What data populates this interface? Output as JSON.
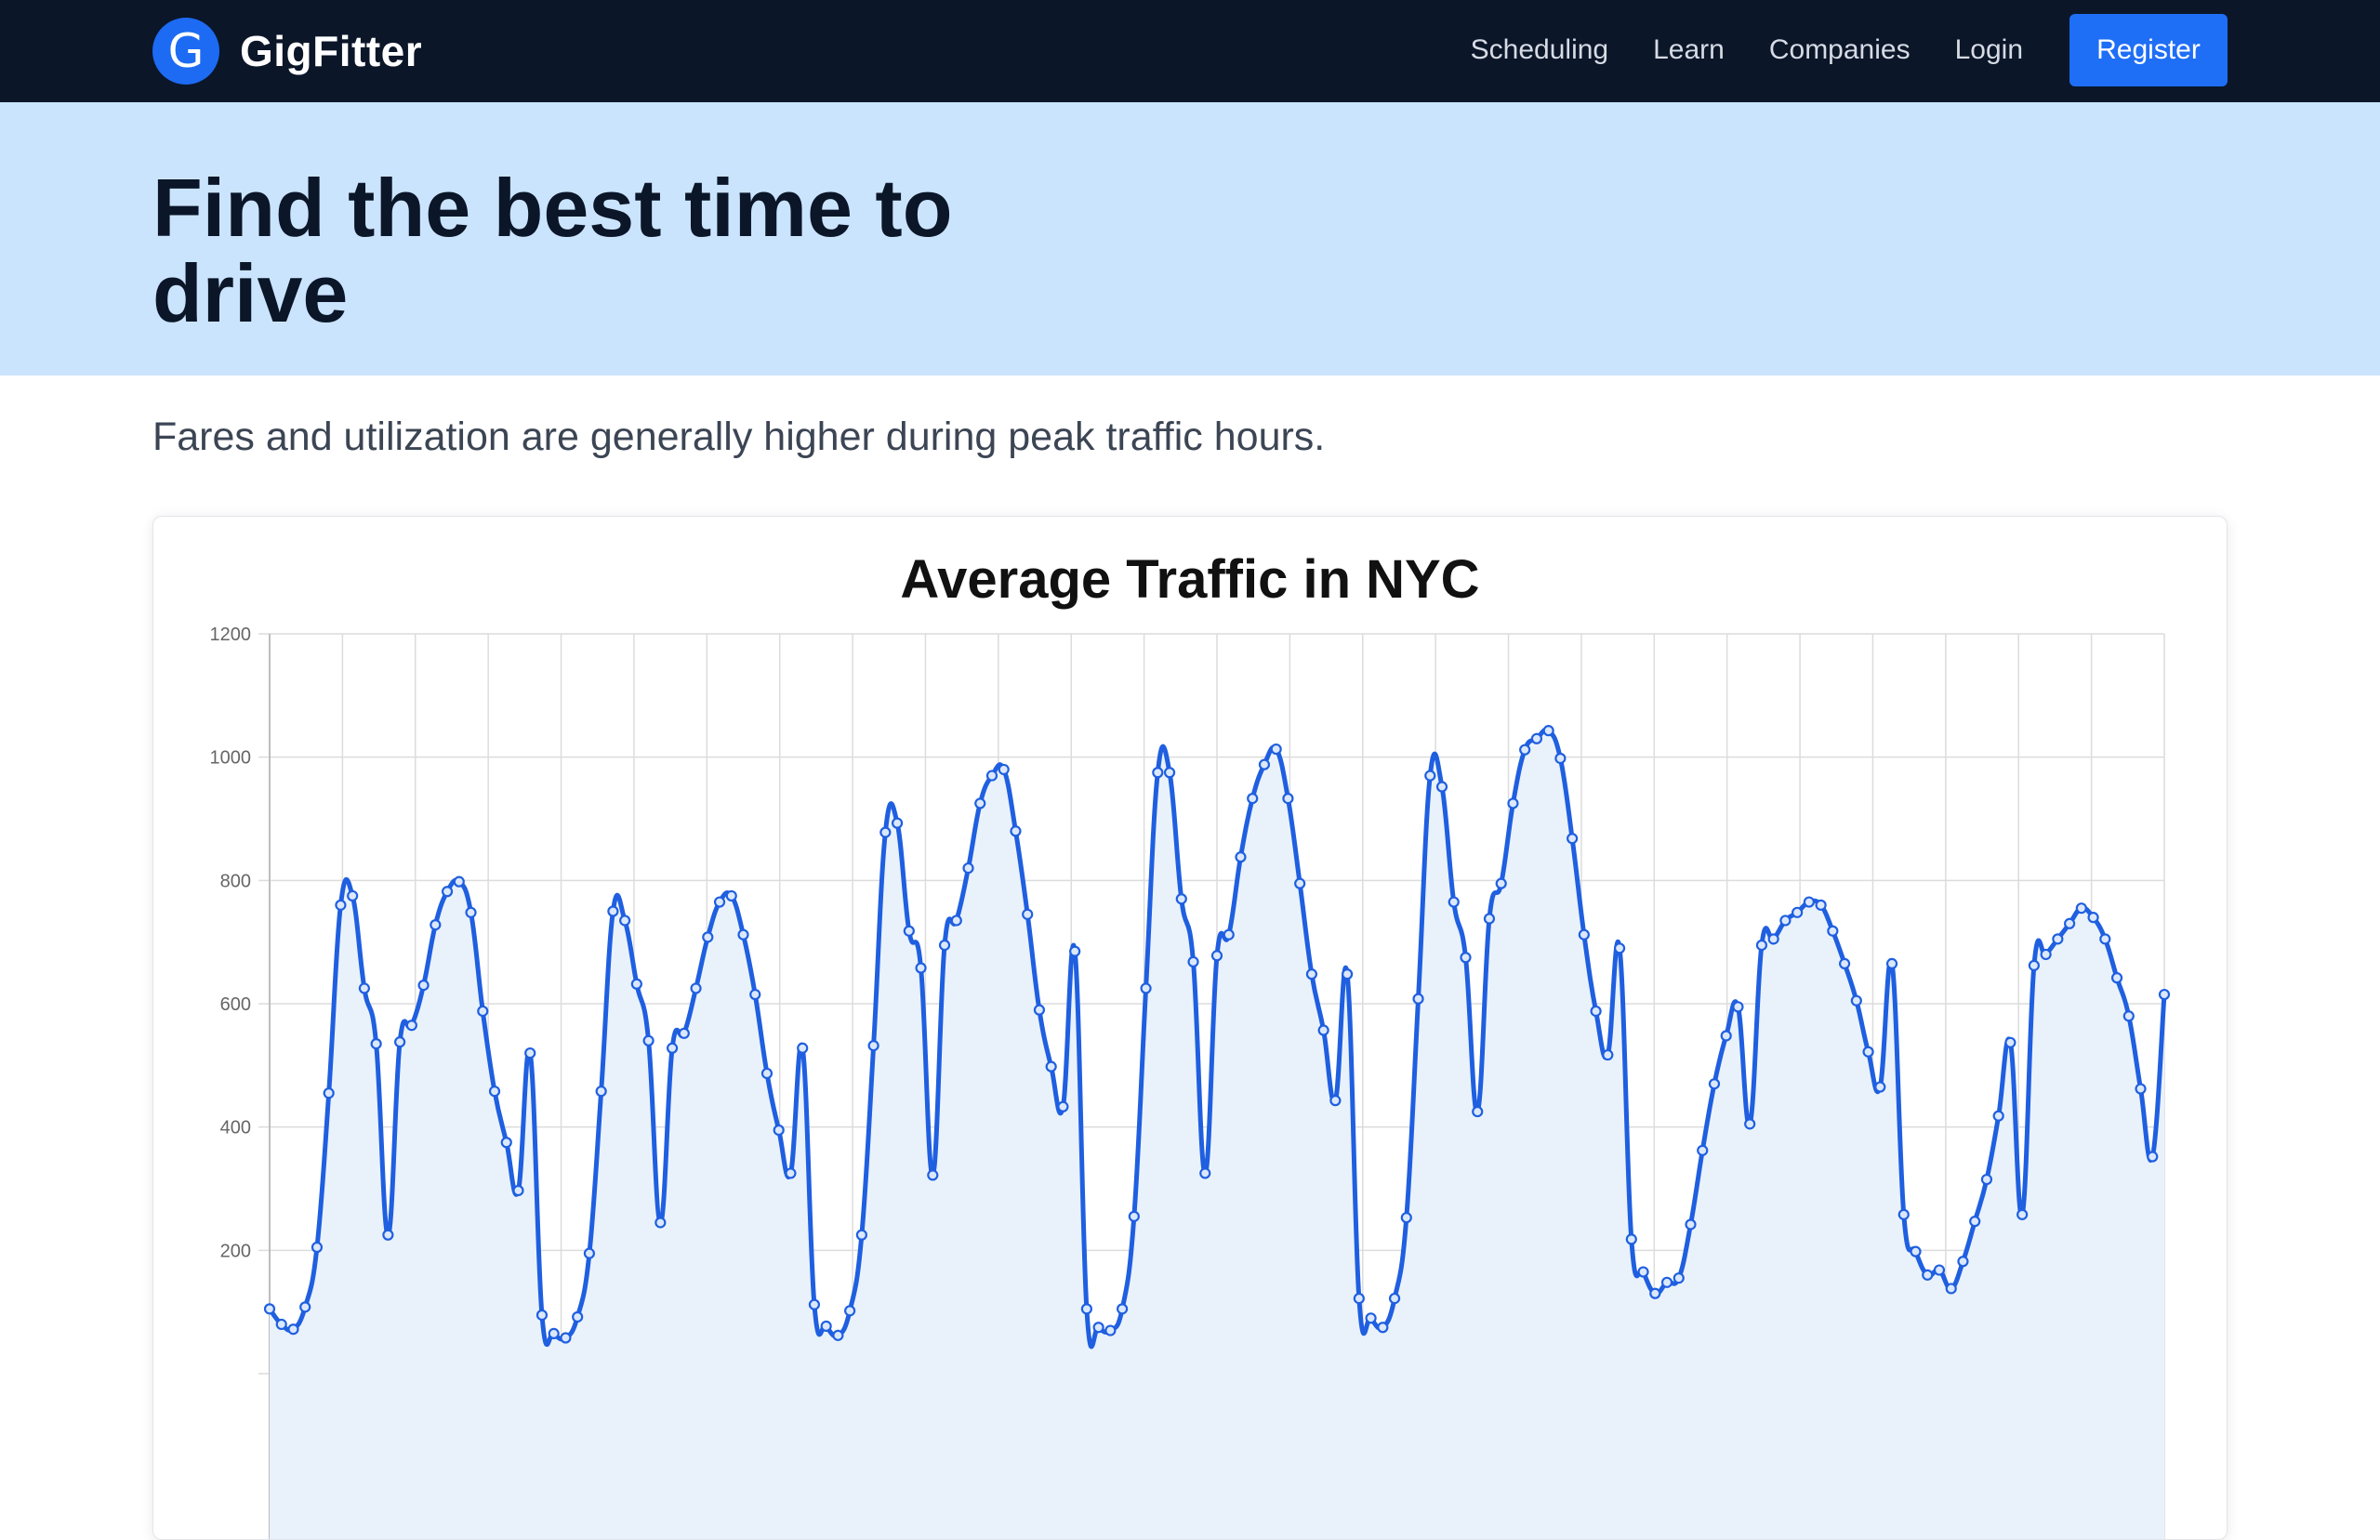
{
  "navbar": {
    "brand_letter": "G",
    "brand_name": "GigFitter",
    "links": [
      "Scheduling",
      "Learn",
      "Companies",
      "Login"
    ],
    "register_label": "Register",
    "background": "#0b1629",
    "accent": "#1f6ef6"
  },
  "hero": {
    "title": "Find the best time to drive",
    "background": "#cbe4fd"
  },
  "subtitle": "Fares and utilization are generally higher during peak traffic hours.",
  "chart_data": {
    "type": "area",
    "title": "Average Traffic in NYC",
    "xlabel": "",
    "ylabel": "",
    "ylim": [
      0,
      1200
    ],
    "y_ticks": [
      200,
      400,
      600,
      800,
      1000,
      1200
    ],
    "grid": true,
    "line_color": "#1f5fe0",
    "fill_color": "#e9f2fb",
    "values": [
      105,
      80,
      72,
      108,
      205,
      455,
      760,
      775,
      625,
      535,
      225,
      538,
      565,
      630,
      728,
      782,
      798,
      748,
      588,
      458,
      375,
      297,
      520,
      95,
      65,
      58,
      92,
      195,
      458,
      750,
      735,
      632,
      540,
      245,
      528,
      552,
      625,
      708,
      765,
      775,
      712,
      615,
      487,
      395,
      325,
      528,
      112,
      77,
      62,
      102,
      225,
      532,
      878,
      893,
      718,
      658,
      322,
      695,
      735,
      820,
      925,
      970,
      980,
      880,
      745,
      590,
      498,
      433,
      685,
      105,
      75,
      70,
      105,
      255,
      625,
      975,
      975,
      770,
      668,
      325,
      678,
      712,
      838,
      933,
      988,
      1013,
      933,
      795,
      648,
      557,
      443,
      648,
      122,
      90,
      75,
      122,
      253,
      608,
      970,
      952,
      765,
      675,
      425,
      738,
      795,
      925,
      1012,
      1030,
      1043,
      998,
      868,
      712,
      588,
      517,
      690,
      218,
      165,
      130,
      148,
      155,
      242,
      362,
      470,
      548,
      595,
      405,
      695,
      705,
      735,
      748,
      765,
      760,
      718,
      665,
      605,
      522,
      465,
      665,
      258,
      198,
      160,
      168,
      138,
      182,
      247,
      315,
      418,
      537,
      258,
      662,
      680,
      705,
      730,
      755,
      740,
      705,
      642,
      580,
      462,
      352,
      615
    ]
  }
}
